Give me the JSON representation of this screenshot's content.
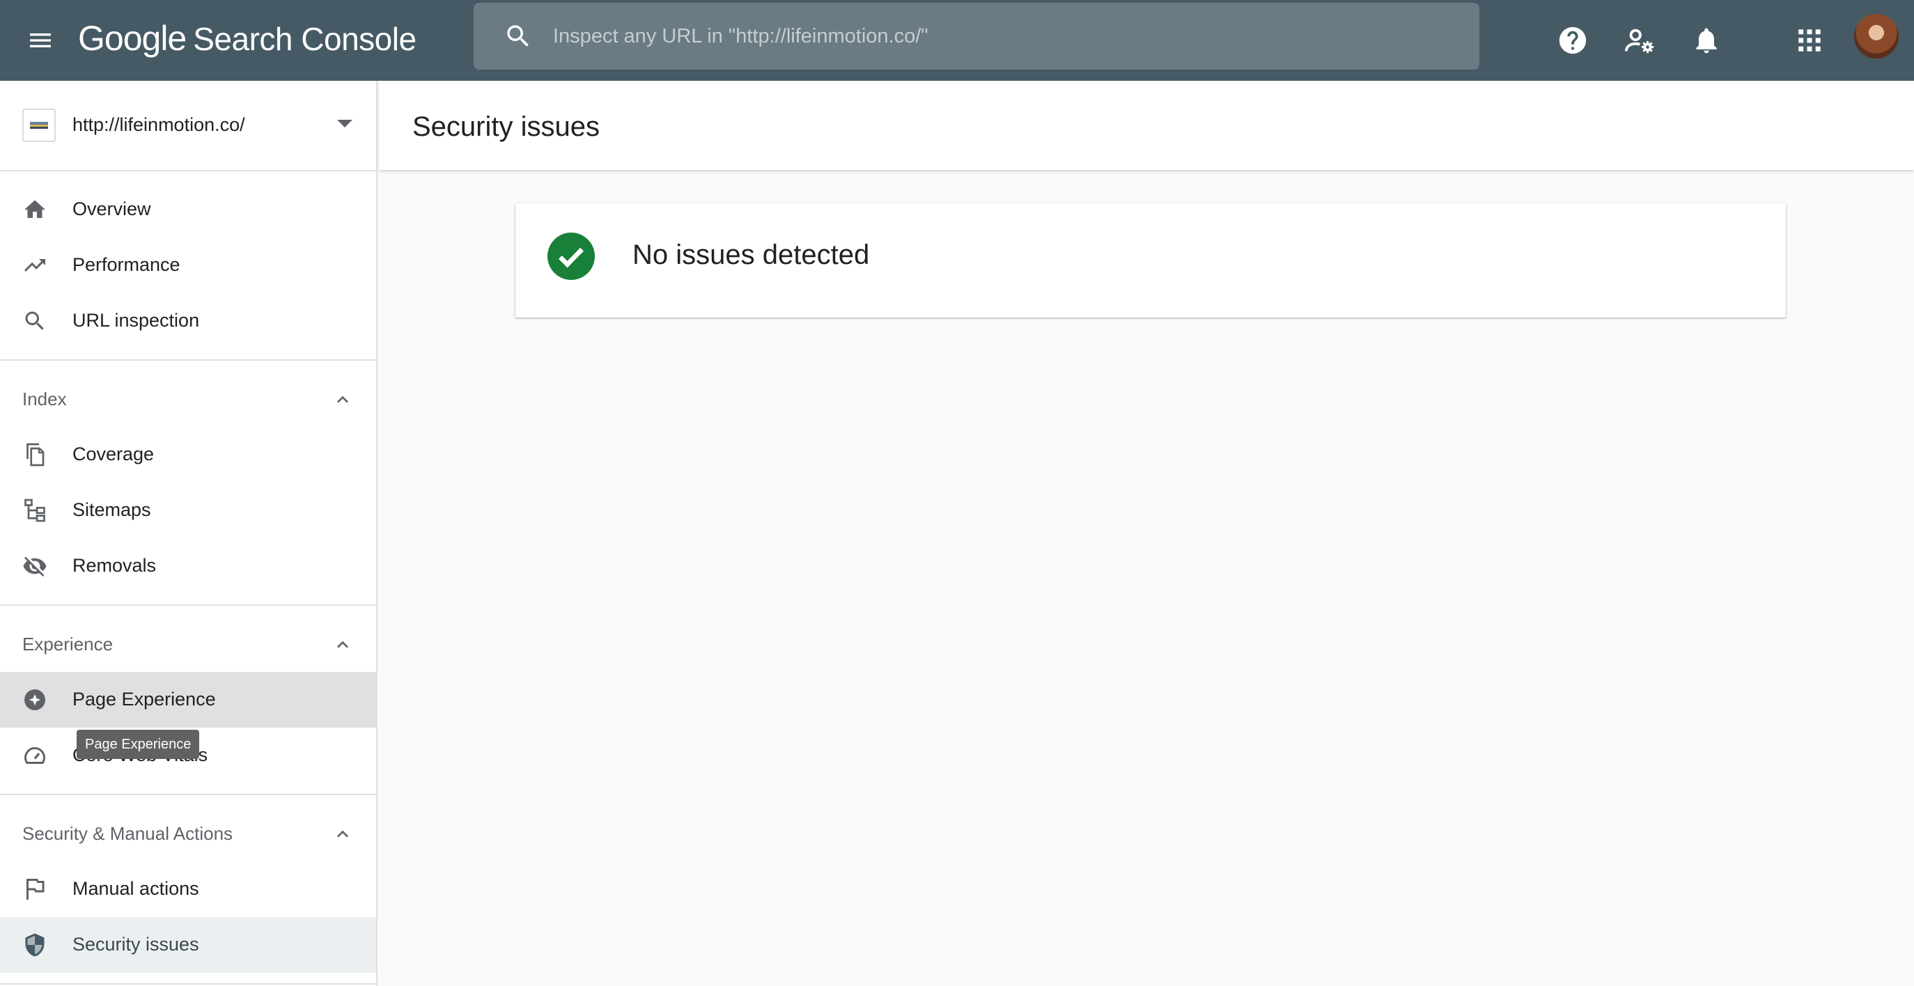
{
  "app": {
    "brand_google": "Google",
    "brand_product": "Search Console"
  },
  "topbar": {
    "search_placeholder": "Inspect any URL in \"http://lifeinmotion.co/\"",
    "icons": [
      "menu-icon",
      "search-icon",
      "help-icon",
      "manage-users-icon",
      "notifications-icon",
      "apps-icon",
      "avatar"
    ]
  },
  "property": {
    "url": "http://lifeinmotion.co/"
  },
  "sidebar": {
    "top_items": [
      {
        "label": "Overview",
        "icon": "home-icon"
      },
      {
        "label": "Performance",
        "icon": "trending-up-icon"
      },
      {
        "label": "URL inspection",
        "icon": "search-icon"
      }
    ],
    "sections": [
      {
        "title": "Index",
        "items": [
          {
            "label": "Coverage",
            "icon": "file-copy-icon"
          },
          {
            "label": "Sitemaps",
            "icon": "sitemap-icon"
          },
          {
            "label": "Removals",
            "icon": "visibility-off-icon"
          }
        ]
      },
      {
        "title": "Experience",
        "items": [
          {
            "label": "Page Experience",
            "icon": "star-circle-icon"
          },
          {
            "label": "Core Web Vitals",
            "icon": "speedometer-icon"
          }
        ]
      },
      {
        "title": "Security & Manual Actions",
        "items": [
          {
            "label": "Manual actions",
            "icon": "flag-icon"
          },
          {
            "label": "Security issues",
            "icon": "shield-icon"
          }
        ]
      }
    ],
    "tooltip": "Page Experience"
  },
  "main": {
    "title": "Security issues",
    "status": "No issues detected"
  },
  "colors": {
    "topbar": "#455a64",
    "success": "#188038",
    "active_item": "#eceff1"
  }
}
